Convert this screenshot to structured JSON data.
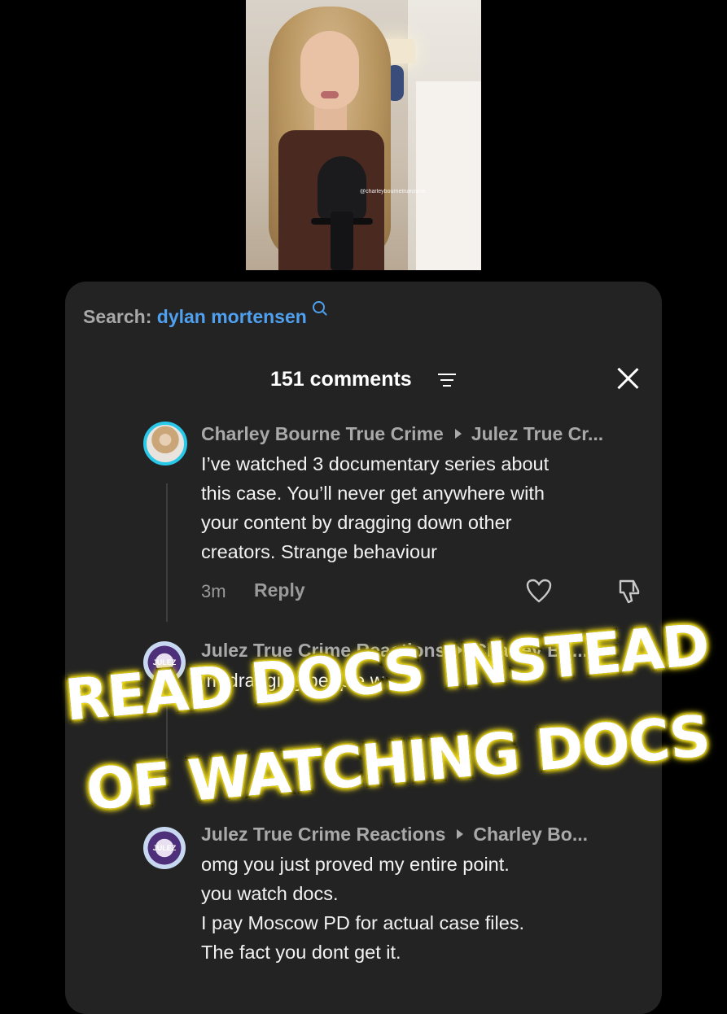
{
  "video": {
    "watermark": "@charleybournetruecrime"
  },
  "search": {
    "label": "Search:",
    "term": "dylan mortensen"
  },
  "header": {
    "comment_count": "151 comments"
  },
  "comments": [
    {
      "author": "Charley Bourne True Crime",
      "reply_to": "Julez True Cr...",
      "text": "I’ve watched 3 documentary series about\nthis case. You’ll never get anywhere with\nyour content by dragging down other\ncreators. Strange behaviour",
      "time": "3m",
      "reply_label": "Reply"
    },
    {
      "author": "Julez True Crime Reactions",
      "reply_to": "Charley Bo...",
      "text": "Im dragging people w"
    },
    {
      "author": "Julez True Crime Reactions",
      "reply_to": "Charley Bo...",
      "text": "omg you just proved my entire point.\nyou watch docs.\nI pay Moscow PD for actual case files.\nThe fact you dont get it."
    }
  ],
  "overlay": {
    "line1": "READ DOCS INSTEAD",
    "line2": "OF WATCHING DOCS"
  },
  "colors": {
    "accent": "#4fa0ef",
    "panel": "#232323",
    "caption_glow": "#f4e01e"
  }
}
